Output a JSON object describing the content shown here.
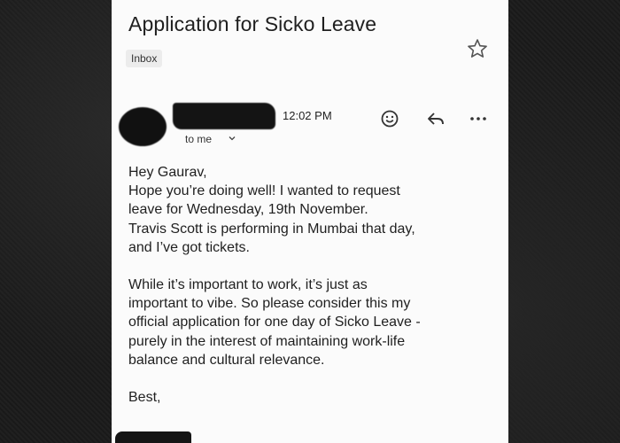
{
  "email": {
    "subject": "Application for Sicko Leave",
    "label": "Inbox",
    "time": "12:02 PM",
    "recipient_line": "to me",
    "body": {
      "greeting": "Hey Gaurav,",
      "paragraph1": "Hope you’re doing well! I wanted to request\nleave for Wednesday, 19th November.\nTravis Scott is performing in Mumbai that day,\nand I’ve got tickets.",
      "paragraph2": "While it’s important to work, it’s just as\nimportant to vibe. So please consider this my\nofficial application for one day of Sicko Leave -\npurely in the interest of maintaining work-life\nbalance and cultural relevance.",
      "closing": "Best,"
    }
  },
  "icons": {
    "star": "star-outline-icon",
    "emoji": "emoji-react-icon",
    "reply": "reply-icon",
    "more": "more-horizontal-icon",
    "chevron": "chevron-down-icon"
  }
}
